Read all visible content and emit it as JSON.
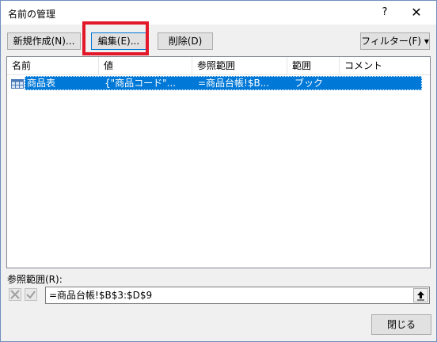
{
  "dialog": {
    "title": "名前の管理",
    "help": "?",
    "close": "✕"
  },
  "toolbar": {
    "new_label": "新規作成(N)...",
    "edit_label": "編集(E)...",
    "delete_label": "削除(D)",
    "filter_label": "フィルター(F) ▾"
  },
  "list": {
    "columns": [
      "名前",
      "値",
      "参照範囲",
      "範囲",
      "コメント"
    ],
    "rows": [
      {
        "name": "商品表",
        "value": "{\"商品コード\"...",
        "ref": "=商品台帳!$B...",
        "scope": "ブック",
        "comment": ""
      }
    ]
  },
  "reference": {
    "label": "参照範囲(R):",
    "value": "=商品台帳!$B$3:$D$9"
  },
  "footer": {
    "close_label": "閉じる"
  },
  "colors": {
    "selection": "#0078d7",
    "highlight_box": "#e3172a"
  }
}
